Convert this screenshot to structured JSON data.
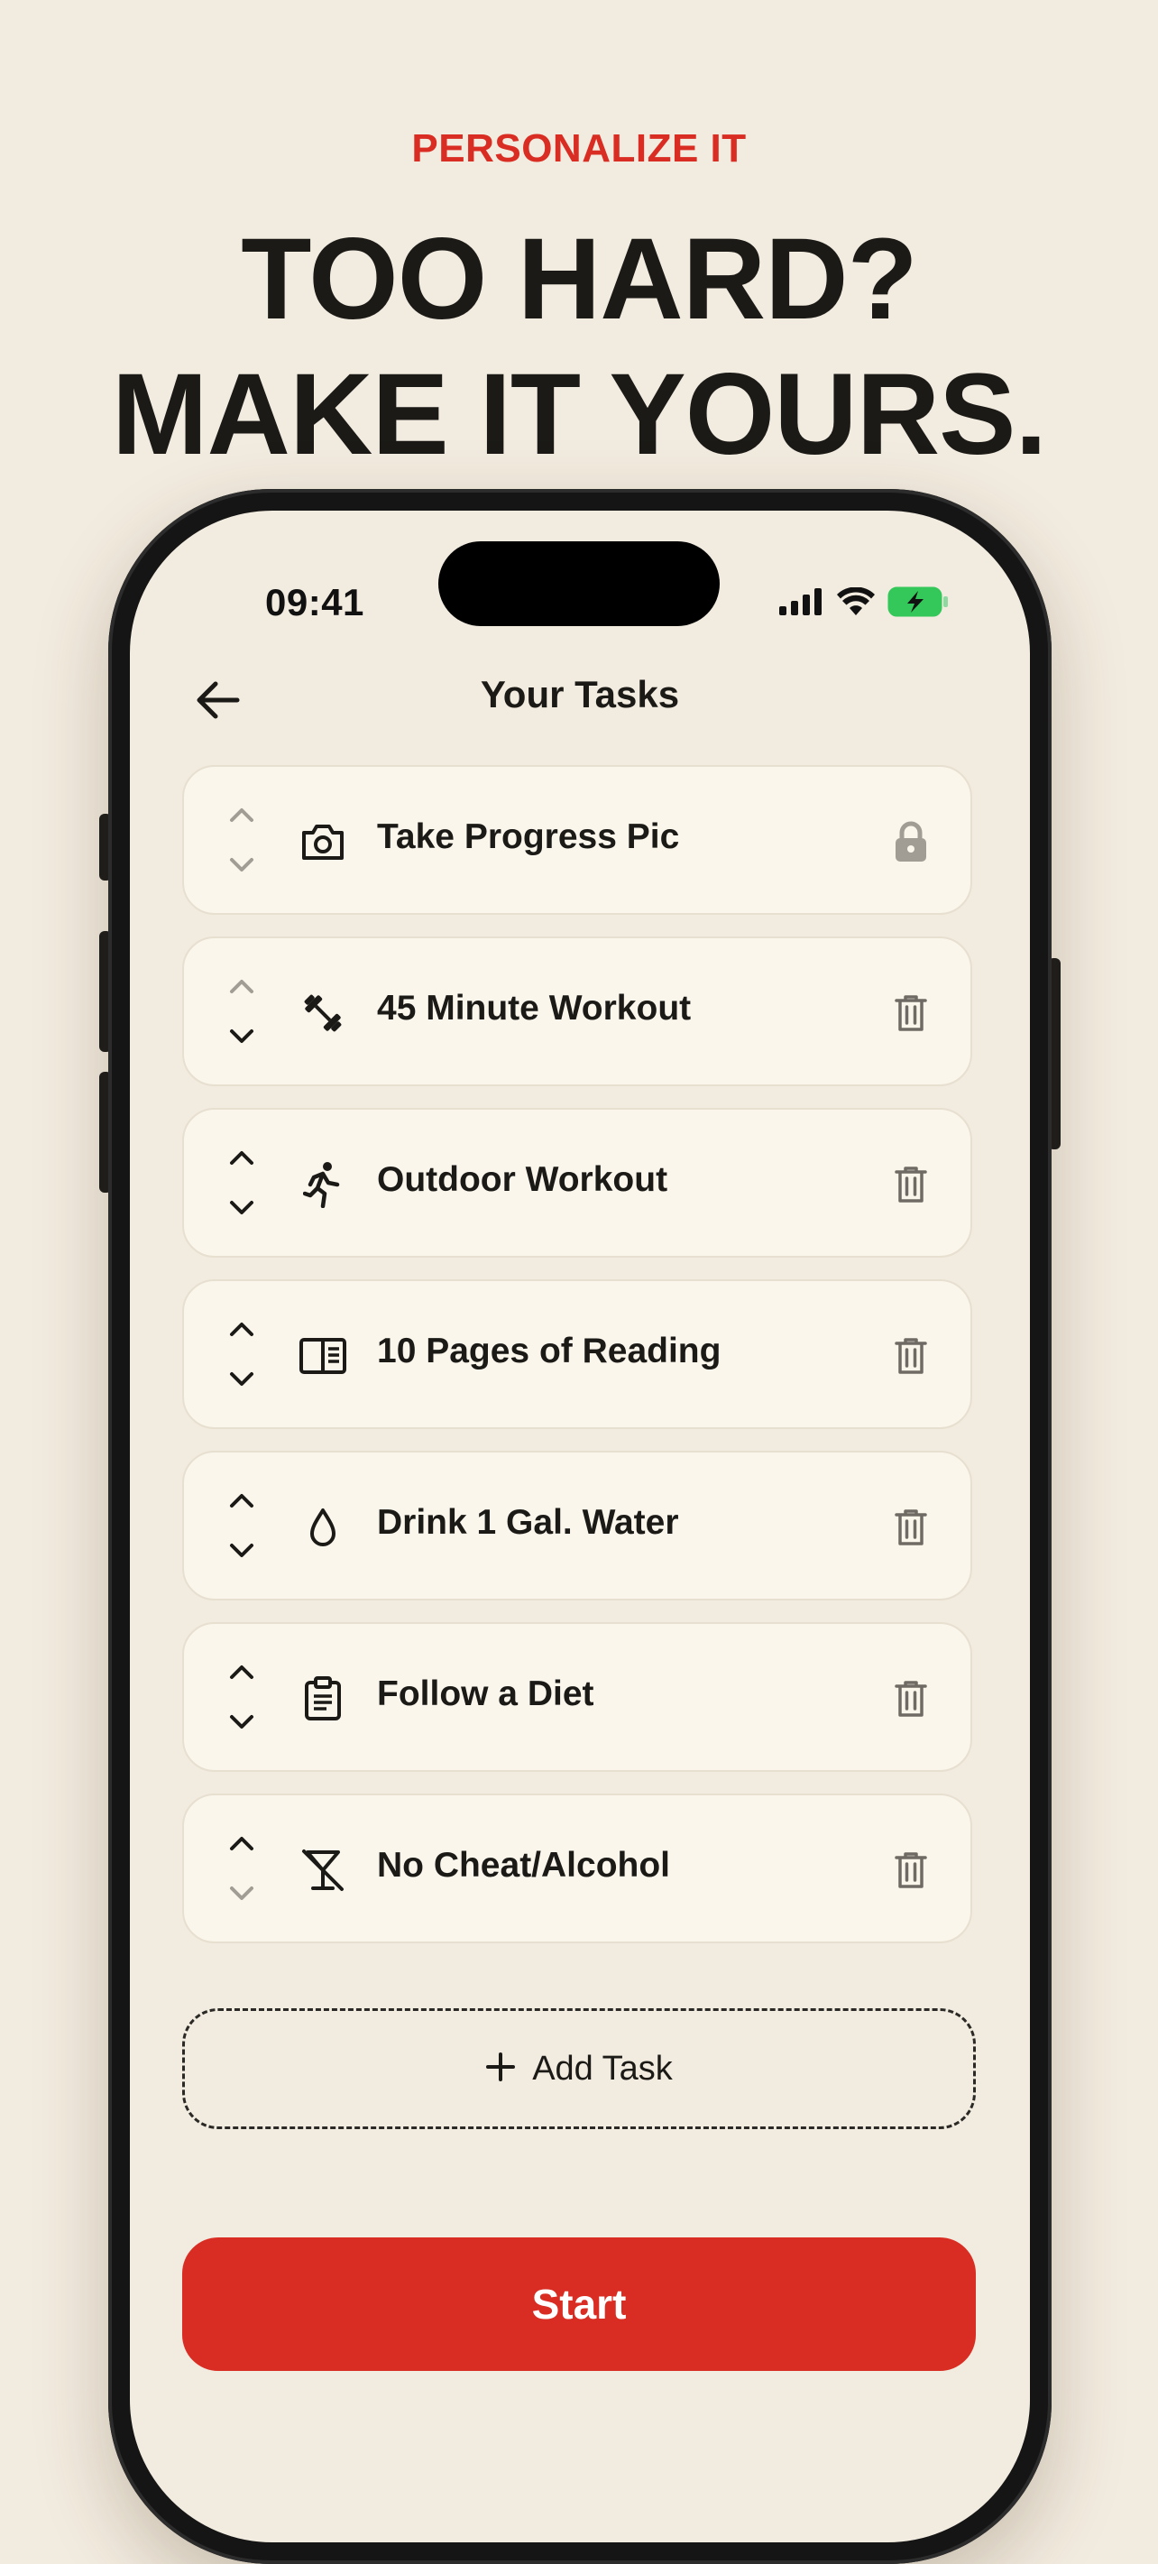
{
  "header": {
    "eyebrow": "PERSONALIZE IT",
    "headline_line1": "TOO HARD?",
    "headline_line2": "MAKE IT YOURS."
  },
  "status_bar": {
    "time": "09:41",
    "icons": [
      "cellular-signal-icon",
      "wifi-icon",
      "battery-charging-icon"
    ]
  },
  "screen": {
    "title": "Your Tasks",
    "back_icon": "arrow-left-icon"
  },
  "tasks": [
    {
      "label": "Take Progress Pic",
      "icon": "camera-icon",
      "action": "lock-icon",
      "up_enabled": false,
      "down_enabled": false
    },
    {
      "label": "45 Minute Workout",
      "icon": "dumbbell-icon",
      "action": "trash-icon",
      "up_enabled": false,
      "down_enabled": true
    },
    {
      "label": "Outdoor Workout",
      "icon": "running-person-icon",
      "action": "trash-icon",
      "up_enabled": true,
      "down_enabled": true
    },
    {
      "label": "10 Pages of Reading",
      "icon": "book-icon",
      "action": "trash-icon",
      "up_enabled": true,
      "down_enabled": true
    },
    {
      "label": "Drink 1 Gal. Water",
      "icon": "water-drop-icon",
      "action": "trash-icon",
      "up_enabled": true,
      "down_enabled": true
    },
    {
      "label": "Follow a Diet",
      "icon": "clipboard-icon",
      "action": "trash-icon",
      "up_enabled": true,
      "down_enabled": true
    },
    {
      "label": "No Cheat/Alcohol",
      "icon": "no-alcohol-icon",
      "action": "trash-icon",
      "up_enabled": true,
      "down_enabled": false
    }
  ],
  "add_task": {
    "label": "Add Task",
    "icon": "plus-icon"
  },
  "start_button": {
    "label": "Start"
  },
  "colors": {
    "accent": "#d92c22",
    "background": "#f2ebdf",
    "card": "#faf6ec",
    "text": "#1b1a17",
    "muted_icon": "#a19d95",
    "battery": "#34c759"
  }
}
